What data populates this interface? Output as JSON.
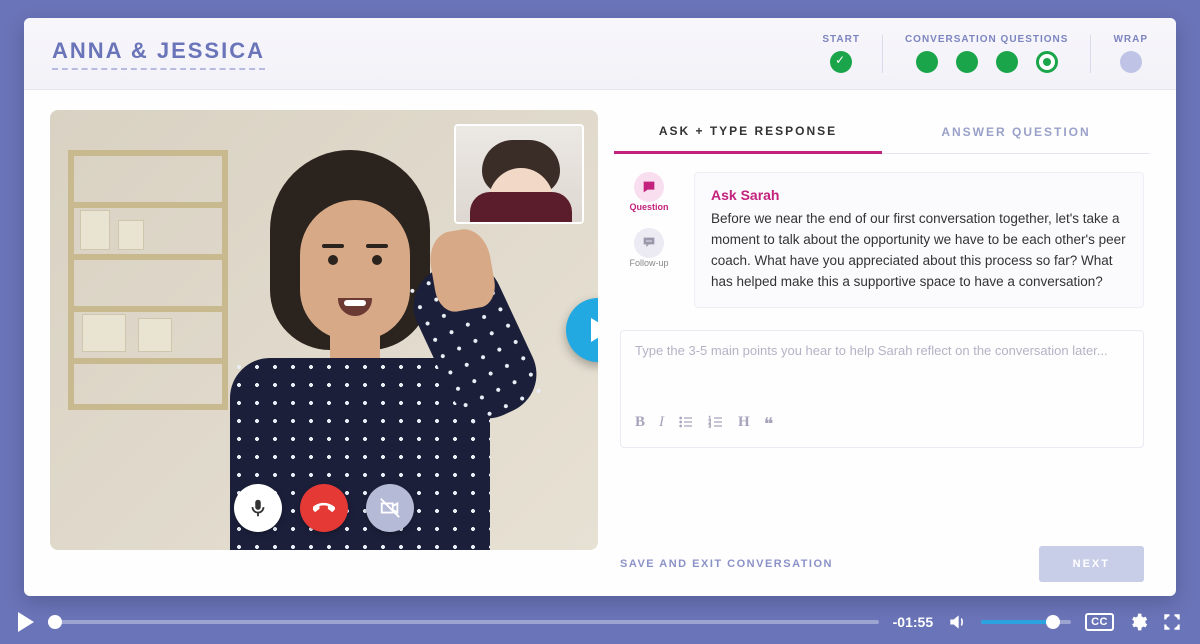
{
  "header": {
    "title": "ANNA & JESSICA",
    "steps": {
      "start": {
        "label": "START"
      },
      "conversation": {
        "label": "CONVERSATION QUESTIONS"
      },
      "wrap": {
        "label": "WRAP"
      }
    }
  },
  "tabs": {
    "ask": "ASK + TYPE RESPONSE",
    "answer": "ANSWER QUESTION"
  },
  "sidebarLabels": {
    "question": "Question",
    "followup": "Follow-up"
  },
  "question": {
    "title": "Ask Sarah",
    "body": "Before we near the end of our first conversation together, let's take a moment to talk about the opportunity we have to be each other's peer coach. What have you appreciated about this process so far? What has helped make this a supportive space to have a conversation?"
  },
  "editor": {
    "placeholder": "Type the 3-5 main points you hear to help Sarah reflect on the conversation later..."
  },
  "footer": {
    "saveExit": "SAVE AND EXIT CONVERSATION",
    "next": "NEXT"
  },
  "player": {
    "time": "-01:55",
    "cc": "CC"
  },
  "colors": {
    "accent": "#c3227d",
    "brand": "#6a74b8",
    "green": "#1aa54a",
    "playerBlue": "#2aa3e0"
  }
}
